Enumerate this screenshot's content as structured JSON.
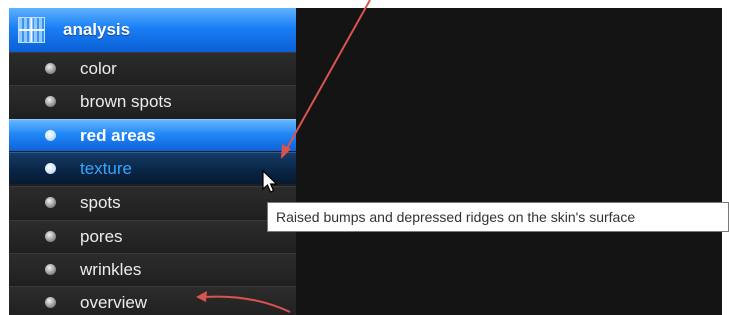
{
  "sidebar": {
    "header": {
      "title": "analysis",
      "icon": "grid-chart-icon"
    },
    "items": [
      {
        "label": "color",
        "state": "normal"
      },
      {
        "label": "brown spots",
        "state": "normal"
      },
      {
        "label": "red areas",
        "state": "selected"
      },
      {
        "label": "texture",
        "state": "hovered"
      },
      {
        "label": "spots",
        "state": "normal"
      },
      {
        "label": "pores",
        "state": "normal"
      },
      {
        "label": "wrinkles",
        "state": "normal"
      },
      {
        "label": "overview",
        "state": "normal"
      }
    ]
  },
  "tooltip": {
    "text": "Raised bumps and depressed ridges on the skin's surface"
  },
  "colors": {
    "accent_blue": "#1a7ef6",
    "hover_text": "#35a6ff",
    "sidebar_bg": "#1f1f1f",
    "content_bg": "#141414",
    "annotation_arrow": "#d9534f"
  }
}
